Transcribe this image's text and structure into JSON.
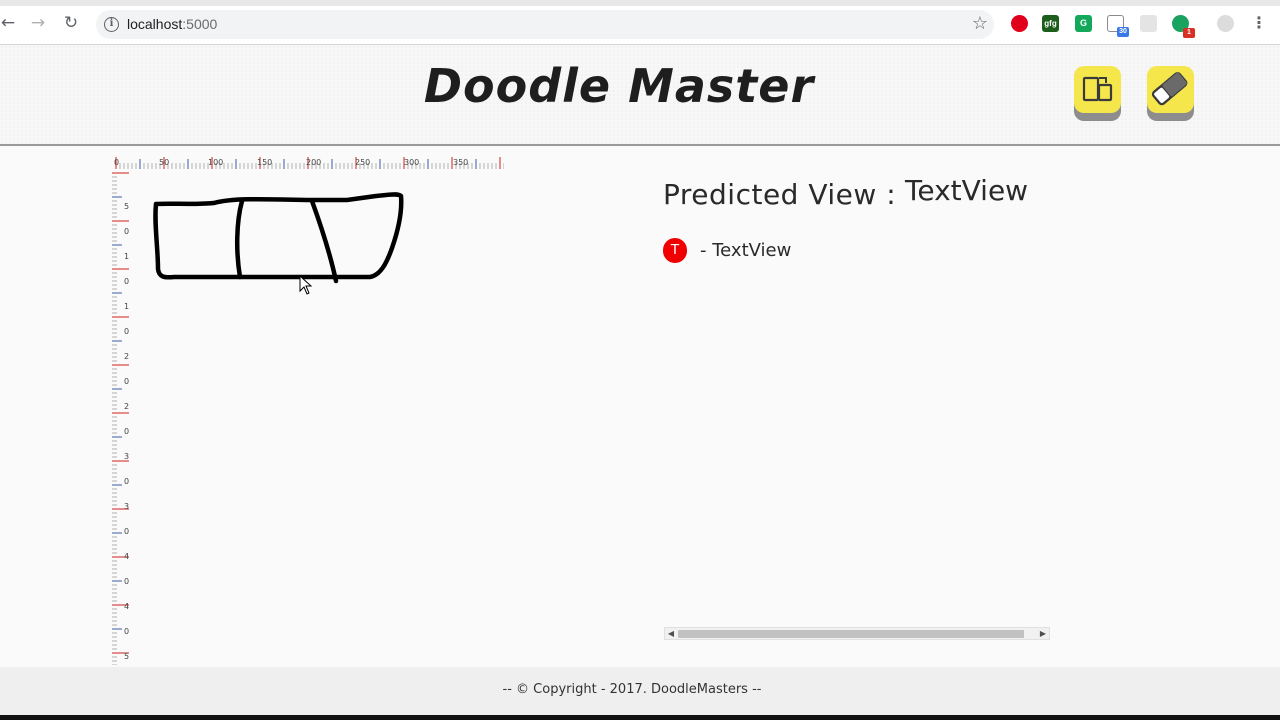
{
  "browser": {
    "url_host": "localhost",
    "url_port": ":5000",
    "icons": [
      "back-arrow-icon",
      "forward-arrow-icon",
      "reload-icon",
      "info-icon",
      "bookmark-star-icon",
      "menu-dots-icon"
    ],
    "extensions": [
      {
        "name": "opera-extension-icon",
        "label": "",
        "color": "#e0001b"
      },
      {
        "name": "gfg-extension-icon",
        "label": "gfg",
        "color": "#1d5e1d"
      },
      {
        "name": "grammarly-extension-icon",
        "label": "G",
        "color": "#13a85a"
      },
      {
        "name": "mail-extension-icon",
        "label": "",
        "color": "#8a8a8a",
        "badge": "30",
        "badge_color": "#3b78e7"
      },
      {
        "name": "puzzle-extension-icon",
        "label": "",
        "color": "#d8d8d8"
      },
      {
        "name": "green-extension-icon",
        "label": "",
        "color": "#1aa260",
        "badge": "1",
        "badge_color": "#d93025"
      },
      {
        "name": "profile-extension-icon",
        "label": "",
        "color": "#cccccc"
      }
    ]
  },
  "app": {
    "title": "Doodle Master",
    "tools": [
      {
        "name": "convert-view-icon"
      },
      {
        "name": "eraser-icon"
      }
    ]
  },
  "canvas": {
    "top_ruler_labels": [
      "0",
      "50",
      "100",
      "150",
      "200",
      "250",
      "300",
      "350"
    ],
    "left_ruler_labels": [
      "5",
      "0",
      "1",
      "0",
      "1",
      "0",
      "2",
      "0",
      "2",
      "0",
      "3",
      "0",
      "3",
      "0",
      "4",
      "0",
      "4",
      "0",
      "5"
    ]
  },
  "prediction": {
    "heading": "Predicted View :",
    "value": "TextView",
    "items": [
      {
        "badge": "T",
        "label": "- TextView",
        "badge_color": "#f00000"
      }
    ]
  },
  "footer": {
    "text": "-- © Copyright - 2017. DoodleMasters --"
  }
}
